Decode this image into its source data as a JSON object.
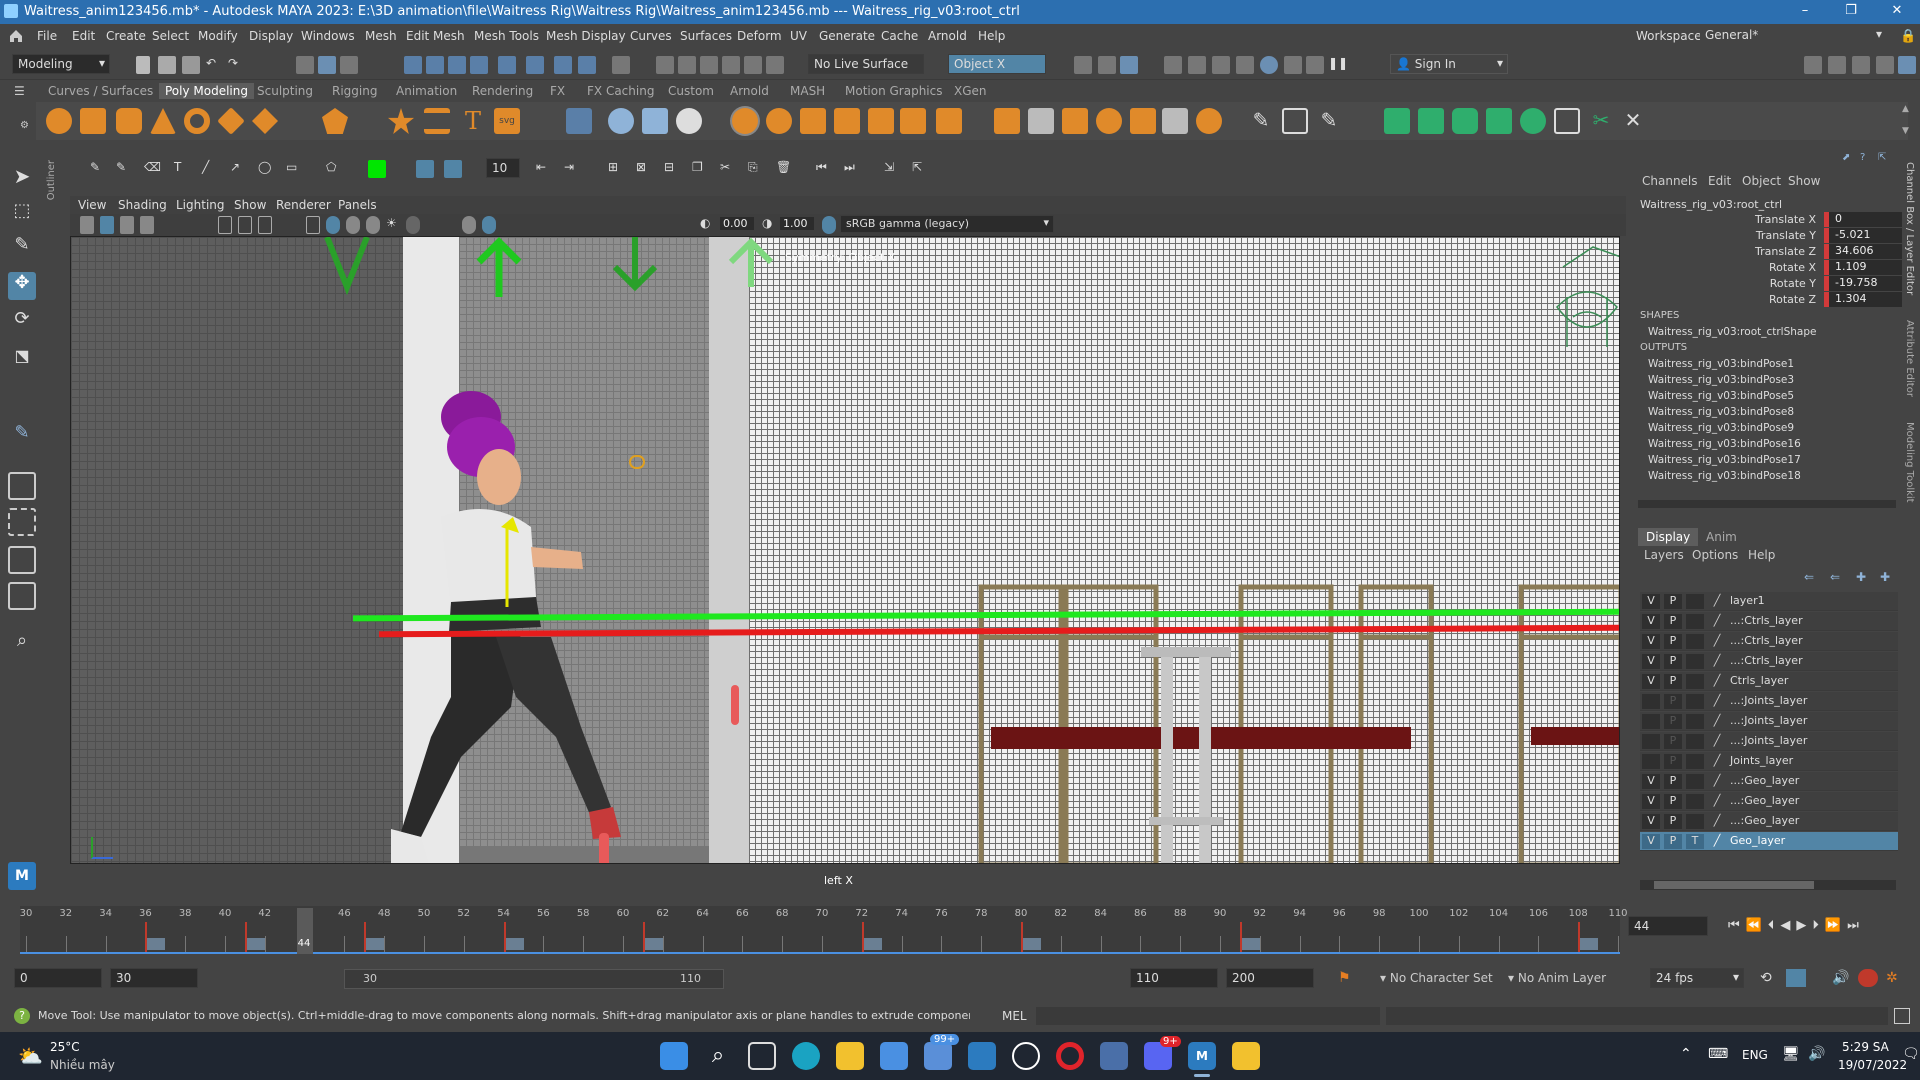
{
  "window": {
    "title": "Waitress_anim123456.mb* - Autodesk MAYA 2023: E:\\3D animation\\file\\Waitress Rig\\Waitress Rig\\Waitress_anim123456.mb  ---  Waitress_rig_v03:root_ctrl",
    "controls": [
      "–",
      "❐",
      "✕"
    ]
  },
  "menubar": {
    "items": [
      "File",
      "Edit",
      "Create",
      "Select",
      "Modify",
      "Display",
      "Windows",
      "Mesh",
      "Edit Mesh",
      "Mesh Tools",
      "Mesh Display",
      "Curves",
      "Surfaces",
      "Deform",
      "UV",
      "Generate",
      "Cache",
      "Arnold",
      "Help"
    ],
    "workspace_label": "Workspace:",
    "workspace_value": "General*"
  },
  "statusline": {
    "menuset": "Modeling",
    "live_surface": "No Live Surface",
    "symmetry": "Object X",
    "signin": "Sign In"
  },
  "shelf": {
    "tabs": [
      "Curves / Surfaces",
      "Poly Modeling",
      "Sculpting",
      "Rigging",
      "Animation",
      "Rendering",
      "FX",
      "FX Caching",
      "Custom",
      "Arnold",
      "MASH",
      "Motion Graphics",
      "XGen"
    ],
    "active_tab": "Poly Modeling"
  },
  "toolbar2": {
    "brush_size": "10"
  },
  "viewport": {
    "menu": [
      "View",
      "Shading",
      "Lighting",
      "Show",
      "Renderer",
      "Panels"
    ],
    "exposure": "0.00",
    "gamma": "1.00",
    "colorspace": "sRGB gamma (legacy)",
    "camera_label": "left X",
    "symmetry_hint": "Symmetry: Object X",
    "outliner_label": "Outliner"
  },
  "channelbox": {
    "tabs": [
      "Channels",
      "Edit",
      "Object",
      "Show"
    ],
    "node": "Waitress_rig_v03:root_ctrl",
    "attributes": [
      {
        "label": "Translate X",
        "value": "0"
      },
      {
        "label": "Translate Y",
        "value": "-5.021"
      },
      {
        "label": "Translate Z",
        "value": "34.606"
      },
      {
        "label": "Rotate X",
        "value": "1.109"
      },
      {
        "label": "Rotate Y",
        "value": "-19.758"
      },
      {
        "label": "Rotate Z",
        "value": "1.304"
      }
    ],
    "shapes_header": "SHAPES",
    "shape": "Waitress_rig_v03:root_ctrlShape",
    "outputs_header": "OUTPUTS",
    "outputs": [
      "Waitress_rig_v03:bindPose1",
      "Waitress_rig_v03:bindPose3",
      "Waitress_rig_v03:bindPose5",
      "Waitress_rig_v03:bindPose8",
      "Waitress_rig_v03:bindPose9",
      "Waitress_rig_v03:bindPose16",
      "Waitress_rig_v03:bindPose17",
      "Waitress_rig_v03:bindPose18"
    ],
    "side_tabs": [
      "Channel Box / Layer Editor",
      "Attribute Editor",
      "Modeling Toolkit"
    ]
  },
  "layers": {
    "tabs": [
      "Display",
      "Anim"
    ],
    "menu": [
      "Layers",
      "Options",
      "Help"
    ],
    "rows": [
      {
        "v": "V",
        "p": "P",
        "t": "",
        "name": "layer1"
      },
      {
        "v": "V",
        "p": "P",
        "t": "",
        "name": "...:Ctrls_layer"
      },
      {
        "v": "V",
        "p": "P",
        "t": "",
        "name": "...:Ctrls_layer"
      },
      {
        "v": "V",
        "p": "P",
        "t": "",
        "name": "...:Ctrls_layer"
      },
      {
        "v": "V",
        "p": "P",
        "t": "",
        "name": "Ctrls_layer"
      },
      {
        "v": "",
        "p": "P",
        "t": "",
        "name": "...:Joints_layer"
      },
      {
        "v": "",
        "p": "P",
        "t": "",
        "name": "...:Joints_layer"
      },
      {
        "v": "",
        "p": "P",
        "t": "",
        "name": "...:Joints_layer"
      },
      {
        "v": "",
        "p": "P",
        "t": "",
        "name": "Joints_layer"
      },
      {
        "v": "V",
        "p": "P",
        "t": "",
        "name": "...:Geo_layer"
      },
      {
        "v": "V",
        "p": "P",
        "t": "",
        "name": "...:Geo_layer"
      },
      {
        "v": "V",
        "p": "P",
        "t": "",
        "name": "...:Geo_layer"
      },
      {
        "v": "V",
        "p": "P",
        "t": "T",
        "name": "Geo_layer"
      }
    ],
    "selected_index": 12
  },
  "timeslider": {
    "ticks": [
      "30",
      "32",
      "34",
      "36",
      "38",
      "40",
      "42",
      "44",
      "46",
      "48",
      "50",
      "52",
      "54",
      "56",
      "58",
      "60",
      "62",
      "64",
      "66",
      "68",
      "70",
      "72",
      "74",
      "76",
      "78",
      "80",
      "82",
      "84",
      "86",
      "88",
      "90",
      "92",
      "94",
      "96",
      "98",
      "100",
      "102",
      "104",
      "106",
      "108",
      "110"
    ],
    "current_frame": "44",
    "current_frame_field": "44",
    "keyframes": [
      36,
      41,
      47,
      54,
      61,
      72,
      80,
      91,
      108
    ]
  },
  "range": {
    "anim_start": "0",
    "play_start": "30",
    "slider_start": "30",
    "slider_end": "110",
    "play_end": "110",
    "anim_end": "200",
    "character_set": "No Character Set",
    "anim_layer": "No Anim Layer",
    "fps": "24 fps"
  },
  "helpline": {
    "text": "Move Tool: Use manipulator to move object(s). Ctrl+middle-drag to move components along normals. Shift+drag manipulator axis or plane handles to extrude components or clone objects. Ctrl+Shift+drag to cons",
    "mel_label": "MEL"
  },
  "taskbar": {
    "temp": "25°C",
    "weather": "Nhiều mây",
    "badge1": "99+",
    "badge2": "9+",
    "lang": "ENG",
    "time": "5:29 SA",
    "date": "19/07/2022"
  },
  "colors": {
    "title_bar": "#2c6fb0",
    "key_red": "#c0392b",
    "selected_layer": "#5285a6",
    "timeline_bar": "#4a90e2"
  }
}
